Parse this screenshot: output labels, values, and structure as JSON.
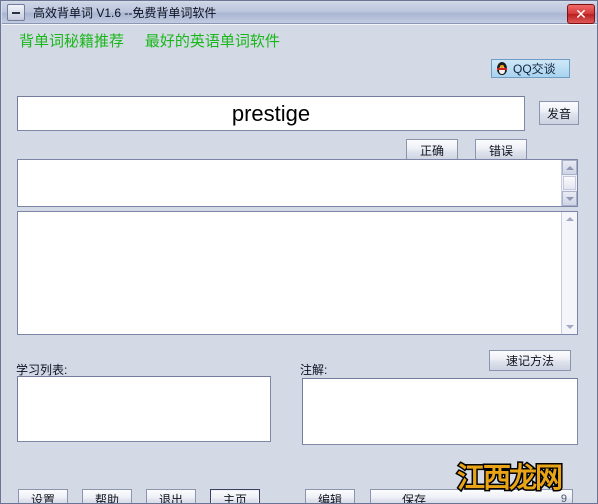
{
  "window": {
    "title": "高效背单词 V1.6  --免费背单词软件",
    "system_menu_icon": "minimize-box-icon",
    "close_label": "✕"
  },
  "banner": {
    "promo_text": "背单词秘籍推荐     最好的英语单词软件",
    "promo_color": "#18b818",
    "qq_button_label": "QQ交谈",
    "qq_icon": "qq-penguin-icon"
  },
  "word_area": {
    "word_value": "prestige",
    "word_placeholder": "",
    "pronounce_label": "发音",
    "correct_label": "正确",
    "wrong_label": "错误"
  },
  "panels": {
    "definition_value": "",
    "notes_value": ""
  },
  "lists": {
    "study_list_label": "学习列表:",
    "study_list_value": "",
    "annotation_label": "注解:",
    "annotation_value": "",
    "mnemonic_button_label": "速记方法"
  },
  "footer": {
    "buttons_left": [
      {
        "label": "设置",
        "name": "settings-button",
        "focused": false
      },
      {
        "label": "帮助",
        "name": "help-button",
        "focused": false
      },
      {
        "label": "退出",
        "name": "exit-button",
        "focused": false
      },
      {
        "label": "主页",
        "name": "homepage-button",
        "focused": true
      }
    ],
    "edit_label": "编辑",
    "save_label": "保存",
    "counter_text": "9"
  },
  "watermark": {
    "text": "江西龙网",
    "fill_color": "#e8a317",
    "stroke_color": "#000000"
  }
}
